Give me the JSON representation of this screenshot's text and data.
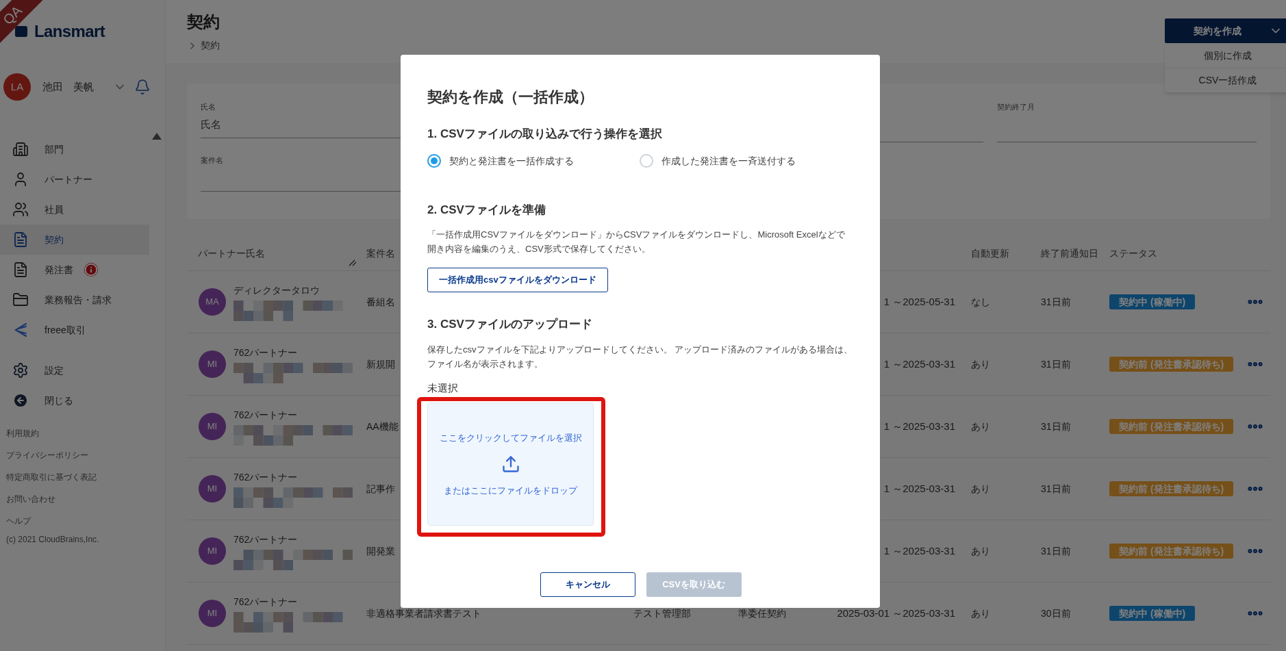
{
  "ribbon": "QA",
  "logo": "Lansmart",
  "user": {
    "initials": "LA",
    "name": "池田　美帆"
  },
  "nav": [
    {
      "label": "部門",
      "selected": false,
      "alert": false
    },
    {
      "label": "パートナー",
      "selected": false,
      "alert": false
    },
    {
      "label": "社員",
      "selected": false,
      "alert": false
    },
    {
      "label": "契約",
      "selected": true,
      "alert": false
    },
    {
      "label": "発注書",
      "selected": false,
      "alert": true
    },
    {
      "label": "業務報告・請求",
      "selected": false,
      "alert": false
    },
    {
      "label": "freee取引",
      "selected": false,
      "alert": false
    }
  ],
  "nav_bottom": [
    {
      "label": "設定"
    },
    {
      "label": "閉じる"
    }
  ],
  "footer_links": [
    "利用規約",
    "プライバシーポリシー",
    "特定商取引に基づく表記",
    "お問い合わせ",
    "ヘルプ"
  ],
  "copyright": "(c) 2021 CloudBrains,Inc.",
  "page": {
    "title": "契約",
    "breadcrumb": "契約"
  },
  "create_button": {
    "label": "契約を作成",
    "expanded": true
  },
  "create_menu": [
    "個別に作成",
    "CSV一括作成"
  ],
  "filters": [
    {
      "label": "氏名",
      "placeholder": "氏名"
    },
    {
      "label": "案件名"
    },
    {
      "label": "契約終了月"
    }
  ],
  "table": {
    "columns": [
      "パートナー氏名",
      "案件名",
      "自動更新",
      "終了前通知日",
      "ステータス"
    ],
    "rows": [
      {
        "initials": "MA",
        "name": "ディレクタータロウ",
        "project": "番組名",
        "period": "1 ～2025-05-31",
        "auto_renew": "なし",
        "notice": "31日前",
        "status": {
          "label": "契約中 (稼働中)",
          "kind": "active"
        }
      },
      {
        "initials": "MI",
        "name": "762パートナー",
        "project": "新規開",
        "period": "1 ～2025-03-31",
        "auto_renew": "あり",
        "notice": "31日前",
        "status": {
          "label": "契約前 (発注書承認待ち)",
          "kind": "pending"
        }
      },
      {
        "initials": "MI",
        "name": "762パートナー",
        "project": "AA機能",
        "period": "1 ～2025-03-31",
        "auto_renew": "あり",
        "notice": "31日前",
        "status": {
          "label": "契約前 (発注書承認待ち)",
          "kind": "pending"
        }
      },
      {
        "initials": "MI",
        "name": "762パートナー",
        "project": "記事作",
        "period": "1 ～2025-03-31",
        "auto_renew": "あり",
        "notice": "31日前",
        "status": {
          "label": "契約前 (発注書承認待ち)",
          "kind": "pending"
        }
      },
      {
        "initials": "MI",
        "name": "762パートナー",
        "project": "開発業",
        "period": "1 ～2025-03-31",
        "auto_renew": "あり",
        "notice": "31日前",
        "status": {
          "label": "契約前 (発注書承認待ち)",
          "kind": "pending"
        }
      },
      {
        "initials": "MI",
        "name": "762パートナー",
        "project": "非適格事業者請求書テスト",
        "department": "テスト管理部",
        "contract_type": "準委任契約",
        "period": "2025-03-01 ～2025-03-31",
        "auto_renew": "あり",
        "notice": "30日前",
        "status": {
          "label": "契約中 (稼働中)",
          "kind": "active"
        }
      }
    ]
  },
  "modal": {
    "title": "契約を作成（一括作成）",
    "section1": {
      "heading": "1. CSVファイルの取り込みで行う操作を選択",
      "options": [
        {
          "label": "契約と発注書を一括作成する",
          "selected": true
        },
        {
          "label": "作成した発注書を一斉送付する",
          "selected": false
        }
      ]
    },
    "section2": {
      "heading": "2. CSVファイルを準備",
      "text": "「一括作成用CSVファイルをダウンロード」からCSVファイルをダウンロードし、Microsoft Excelなどで開き内容を編集のうえ、CSV形式で保存してください。",
      "button": "一括作成用csvファイルをダウンロード"
    },
    "section3": {
      "heading": "3. CSVファイルのアップロード",
      "text": "保存したcsvファイルを下記よりアップロードしてください。 アップロード済みのファイルがある場合は、ファイル名が表示されます。",
      "file_status": "未選択",
      "drop_click": "ここをクリックしてファイルを選択",
      "drop_text": "またはここにファイルをドロップ"
    },
    "buttons": [
      {
        "label": "キャンセル",
        "kind": "secondary",
        "disabled": false
      },
      {
        "label": "CSVを取り込む",
        "kind": "primary",
        "disabled": true
      }
    ]
  }
}
